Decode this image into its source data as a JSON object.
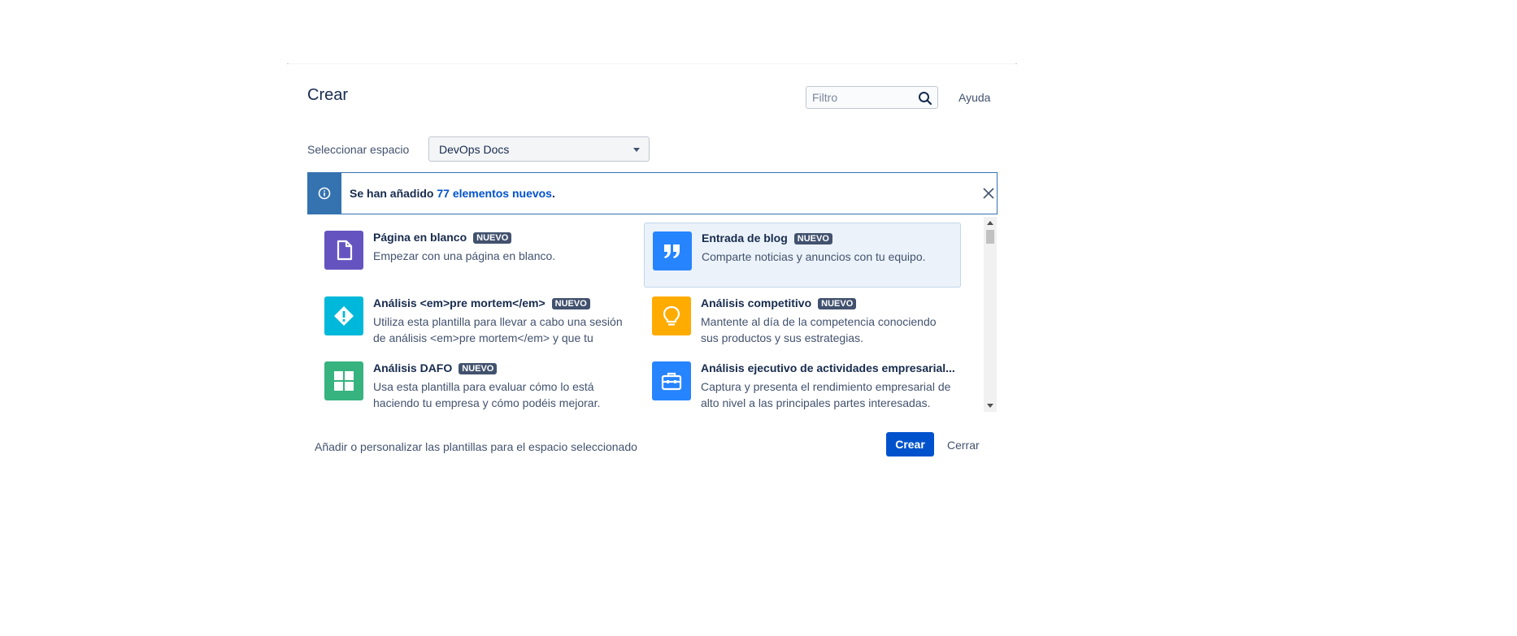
{
  "dialog": {
    "title": "Crear",
    "filter_placeholder": "Filtro",
    "help_label": "Ayuda"
  },
  "space": {
    "label": "Seleccionar espacio",
    "selected": "DevOps Docs"
  },
  "banner": {
    "prefix": "Se han añadido ",
    "link": "77 elementos nuevos",
    "suffix": "."
  },
  "templates": [
    {
      "name": "Página en blanco",
      "badge": "NUEVO",
      "desc": "Empezar con una página en blanco.",
      "icon": "blank-page-icon",
      "color": "#6554c0"
    },
    {
      "name": "Entrada de blog",
      "badge": "NUEVO",
      "desc": "Comparte noticias y anuncios con tu equipo.",
      "icon": "quote-icon",
      "color": "#2684ff"
    },
    {
      "name": "Análisis <em>pre mortem</em>",
      "badge": "NUEVO",
      "desc": "Utiliza esta plantilla para llevar a cabo una sesión de análisis <em>pre mortem</em> y que tu",
      "icon": "warning-diamond-icon",
      "color": "#00b8d9"
    },
    {
      "name": "Análisis competitivo",
      "badge": "NUEVO",
      "desc": "Mantente al día de la competencia conociendo sus productos y sus estrategias.",
      "icon": "lightbulb-icon",
      "color": "#ffab00"
    },
    {
      "name": "Análisis DAFO",
      "badge": "NUEVO",
      "desc": "Usa esta plantilla para evaluar cómo lo está haciendo tu empresa y cómo podéis mejorar.",
      "icon": "grid-icon",
      "color": "#36b37e"
    },
    {
      "name": "Análisis ejecutivo de actividades empresarial...",
      "badge": "",
      "desc": "Captura y presenta el rendimiento empresarial de alto nivel a las principales partes interesadas.",
      "icon": "briefcase-icon",
      "color": "#2684ff"
    }
  ],
  "footer": {
    "customize_link": "Añadir o personalizar las plantillas para el espacio seleccionado",
    "create_button": "Crear",
    "close_button": "Cerrar"
  }
}
